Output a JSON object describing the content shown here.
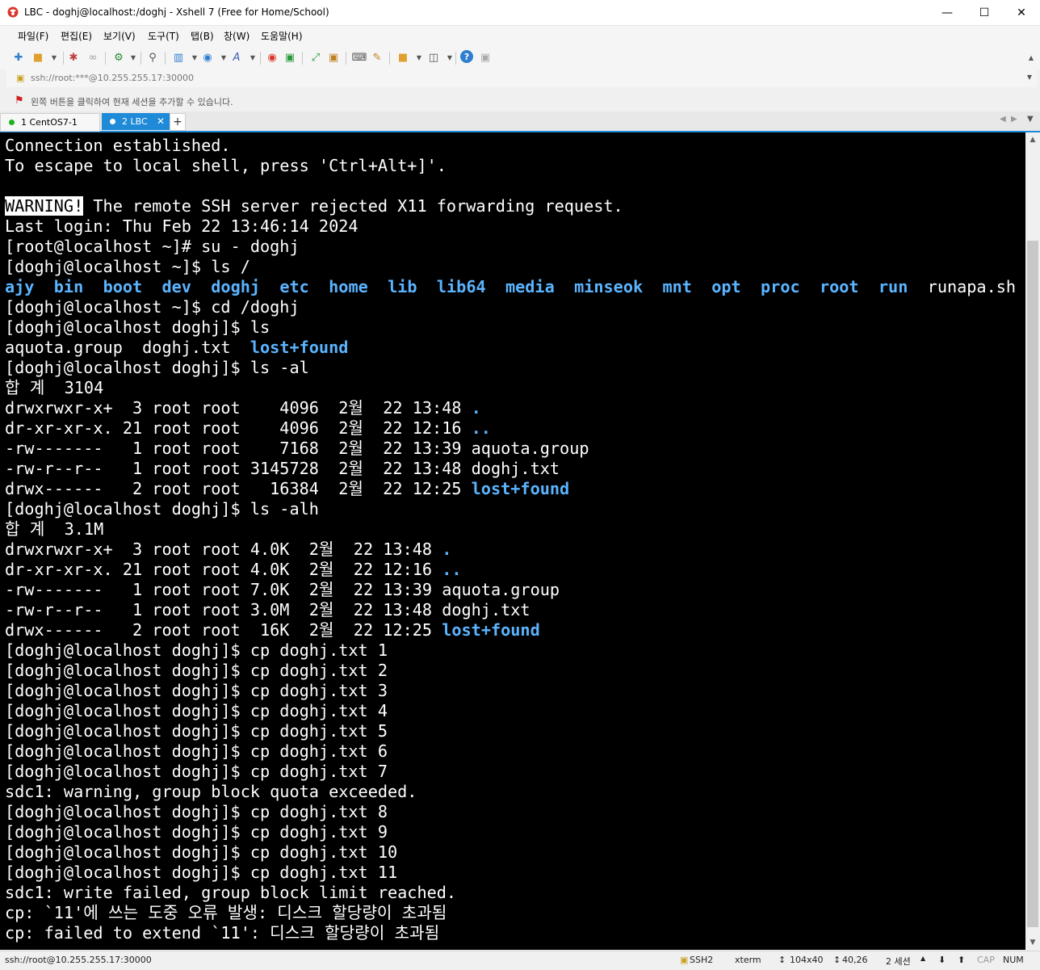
{
  "window": {
    "title": "LBC - doghj@localhost:/doghj - Xshell 7 (Free for Home/School)",
    "accent_color": "#1f8ad8"
  },
  "menu": [
    "파일(F)",
    "편집(E)",
    "보기(V)",
    "도구(T)",
    "탭(B)",
    "창(W)",
    "도움말(H)"
  ],
  "address": {
    "value": "ssh://root:***@10.255.255.17:30000"
  },
  "hint": {
    "text": "왼쪽 버튼을 클릭하여 현재 세션을 추가할 수 있습니다."
  },
  "tabs": [
    {
      "label": "1 CentOS7-1",
      "active": false
    },
    {
      "label": "2 LBC",
      "active": true
    }
  ],
  "terminal": {
    "lines": [
      [
        {
          "t": "Connection established."
        }
      ],
      [
        {
          "t": "To escape to local shell, press 'Ctrl+Alt+]'."
        }
      ],
      [
        {
          "t": ""
        }
      ],
      [
        {
          "t": "WARNING!",
          "s": "warn"
        },
        {
          "t": " The remote SSH server rejected X11 forwarding request."
        }
      ],
      [
        {
          "t": "Last login: Thu Feb 22 13:46:14 2024"
        }
      ],
      [
        {
          "t": "[root@localhost ~]# su - doghj"
        }
      ],
      [
        {
          "t": "[doghj@localhost ~]$ ls /"
        }
      ],
      [
        {
          "t": "ajy",
          "s": "dir"
        },
        {
          "t": "  "
        },
        {
          "t": "bin",
          "s": "dir"
        },
        {
          "t": "  "
        },
        {
          "t": "boot",
          "s": "dir"
        },
        {
          "t": "  "
        },
        {
          "t": "dev",
          "s": "dir"
        },
        {
          "t": "  "
        },
        {
          "t": "doghj",
          "s": "dir"
        },
        {
          "t": "  "
        },
        {
          "t": "etc",
          "s": "dir"
        },
        {
          "t": "  "
        },
        {
          "t": "home",
          "s": "dir"
        },
        {
          "t": "  "
        },
        {
          "t": "lib",
          "s": "dir"
        },
        {
          "t": "  "
        },
        {
          "t": "lib64",
          "s": "dir"
        },
        {
          "t": "  "
        },
        {
          "t": "media",
          "s": "dir"
        },
        {
          "t": "  "
        },
        {
          "t": "minseok",
          "s": "dir"
        },
        {
          "t": "  "
        },
        {
          "t": "mnt",
          "s": "dir"
        },
        {
          "t": "  "
        },
        {
          "t": "opt",
          "s": "dir"
        },
        {
          "t": "  "
        },
        {
          "t": "proc",
          "s": "dir"
        },
        {
          "t": "  "
        },
        {
          "t": "root",
          "s": "dir"
        },
        {
          "t": "  "
        },
        {
          "t": "run",
          "s": "dir"
        },
        {
          "t": "  runapa.sh"
        }
      ],
      [
        {
          "t": "[doghj@localhost ~]$ cd /doghj"
        }
      ],
      [
        {
          "t": "[doghj@localhost doghj]$ ls"
        }
      ],
      [
        {
          "t": "aquota.group  doghj.txt  "
        },
        {
          "t": "lost+found",
          "s": "dir"
        }
      ],
      [
        {
          "t": "[doghj@localhost doghj]$ ls -al"
        }
      ],
      [
        {
          "t": "합 계  3104"
        }
      ],
      [
        {
          "t": "drwxrwxr-x+  3 root root    4096  2월  22 13:48 "
        },
        {
          "t": ".",
          "s": "dir"
        }
      ],
      [
        {
          "t": "dr-xr-xr-x. 21 root root    4096  2월  22 12:16 "
        },
        {
          "t": "..",
          "s": "dir"
        }
      ],
      [
        {
          "t": "-rw-------   1 root root    7168  2월  22 13:39 aquota.group"
        }
      ],
      [
        {
          "t": "-rw-r--r--   1 root root 3145728  2월  22 13:48 doghj.txt"
        }
      ],
      [
        {
          "t": "drwx------   2 root root   16384  2월  22 12:25 "
        },
        {
          "t": "lost+found",
          "s": "dir"
        }
      ],
      [
        {
          "t": "[doghj@localhost doghj]$ ls -alh"
        }
      ],
      [
        {
          "t": "합 계  3.1M"
        }
      ],
      [
        {
          "t": "drwxrwxr-x+  3 root root 4.0K  2월  22 13:48 "
        },
        {
          "t": ".",
          "s": "dir"
        }
      ],
      [
        {
          "t": "dr-xr-xr-x. 21 root root 4.0K  2월  22 12:16 "
        },
        {
          "t": "..",
          "s": "dir"
        }
      ],
      [
        {
          "t": "-rw-------   1 root root 7.0K  2월  22 13:39 aquota.group"
        }
      ],
      [
        {
          "t": "-rw-r--r--   1 root root 3.0M  2월  22 13:48 doghj.txt"
        }
      ],
      [
        {
          "t": "drwx------   2 root root  16K  2월  22 12:25 "
        },
        {
          "t": "lost+found",
          "s": "dir"
        }
      ],
      [
        {
          "t": "[doghj@localhost doghj]$ cp doghj.txt 1"
        }
      ],
      [
        {
          "t": "[doghj@localhost doghj]$ cp doghj.txt 2"
        }
      ],
      [
        {
          "t": "[doghj@localhost doghj]$ cp doghj.txt 3"
        }
      ],
      [
        {
          "t": "[doghj@localhost doghj]$ cp doghj.txt 4"
        }
      ],
      [
        {
          "t": "[doghj@localhost doghj]$ cp doghj.txt 5"
        }
      ],
      [
        {
          "t": "[doghj@localhost doghj]$ cp doghj.txt 6"
        }
      ],
      [
        {
          "t": "[doghj@localhost doghj]$ cp doghj.txt 7"
        }
      ],
      [
        {
          "t": "sdc1: warning, group block quota exceeded."
        }
      ],
      [
        {
          "t": "[doghj@localhost doghj]$ cp doghj.txt 8"
        }
      ],
      [
        {
          "t": "[doghj@localhost doghj]$ cp doghj.txt 9"
        }
      ],
      [
        {
          "t": "[doghj@localhost doghj]$ cp doghj.txt 10"
        }
      ],
      [
        {
          "t": "[doghj@localhost doghj]$ cp doghj.txt 11"
        }
      ],
      [
        {
          "t": "sdc1: write failed, group block limit reached."
        }
      ],
      [
        {
          "t": "cp: `11'에 쓰는 도중 오류 발생: 디스크 할당량이 초과됨"
        }
      ],
      [
        {
          "t": "cp: failed to extend `11': 디스크 할당량이 초과됨"
        }
      ]
    ],
    "dir_color": "#5bb4ff"
  },
  "status": {
    "connection": "ssh://root@10.255.255.17:30000",
    "protocol": "SSH2",
    "terminal_type": "xterm",
    "size": "104x40",
    "cursor": "40,26",
    "sessions": "2 세션",
    "cap": "CAP",
    "num": "NUM"
  }
}
